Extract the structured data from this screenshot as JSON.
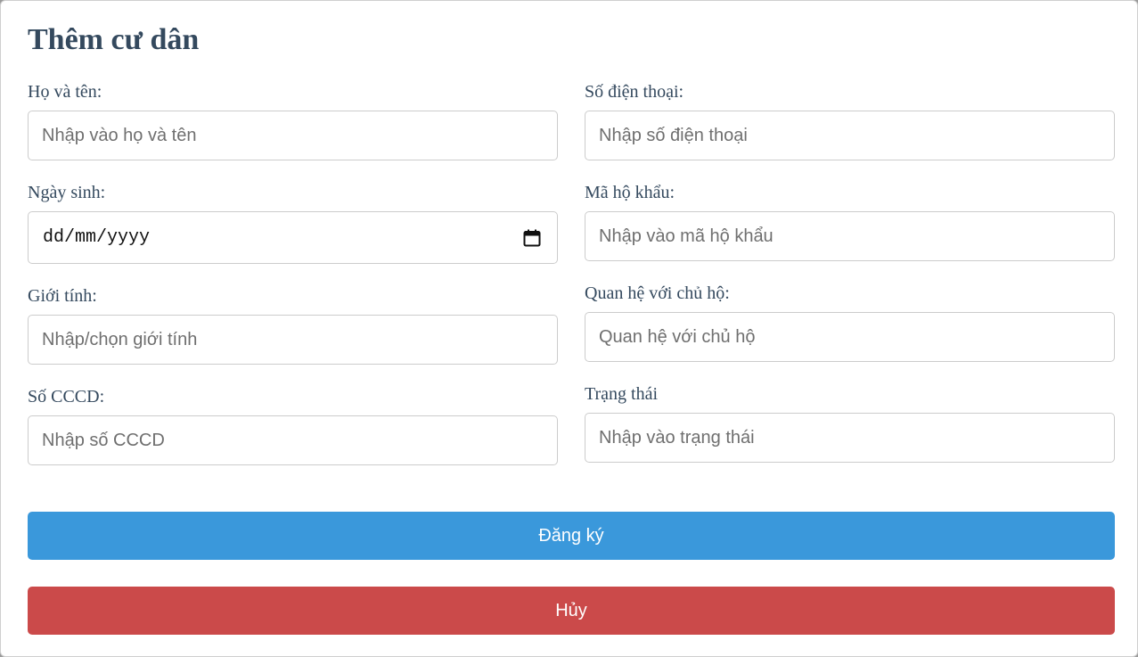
{
  "form": {
    "title": "Thêm cư dân",
    "left": [
      {
        "label": "Họ và tên:",
        "placeholder": "Nhập vào họ và tên"
      },
      {
        "label": "Ngày sinh:",
        "value": "dd/mm/yyyy",
        "icon": "calendar-icon"
      },
      {
        "label": "Giới tính:",
        "placeholder": "Nhập/chọn giới tính"
      },
      {
        "label": "Số CCCD:",
        "placeholder": "Nhập số CCCD"
      }
    ],
    "right": [
      {
        "label": "Số điện thoại:",
        "placeholder": "Nhập số điện thoại"
      },
      {
        "label": "Mã hộ khẩu:",
        "placeholder": "Nhập vào mã hộ khẩu"
      },
      {
        "label": "Quan hệ với chủ hộ:",
        "placeholder": "Quan hệ với chủ hộ"
      },
      {
        "label": "Trạng thái",
        "placeholder": "Nhập vào trạng thái"
      }
    ],
    "submit_label": "Đăng ký",
    "cancel_label": "Hủy"
  },
  "colors": {
    "title": "#34495e",
    "primary": "#3a98db",
    "danger": "#cb4a4a"
  }
}
